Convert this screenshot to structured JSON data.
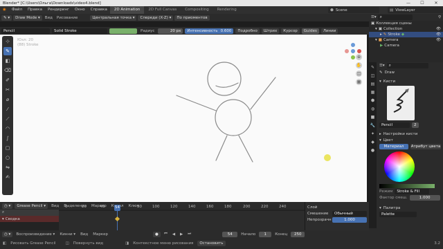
{
  "window": {
    "title": "Blender* [C:\\Users\\Ольга\\Downloads\\video4.blend]"
  },
  "menu": {
    "items": [
      "Файл",
      "Правка",
      "Рендеринг",
      "Окно",
      "Справка"
    ]
  },
  "workspace_tabs": [
    {
      "label": "2D Animation",
      "active": true
    },
    {
      "label": "2D Full Canvas",
      "active": false
    },
    {
      "label": "Compositing",
      "active": false
    },
    {
      "label": "Rendering",
      "active": false
    }
  ],
  "scene": {
    "name": "Scene"
  },
  "view_layer": {
    "name": "ViewLayer"
  },
  "header": {
    "mode": "Draw Mode",
    "view": "Вид",
    "draw": "Рисование",
    "pivot": "Центральная точка",
    "orient": "Спереди (X-Z)",
    "snap": "По приоментов"
  },
  "tool_header": {
    "brush": "Pencil",
    "material": "Solid Stroke",
    "radius_label": "Радиус",
    "radius_value": "20 px",
    "strength_label": "Интенсивность",
    "strength_value": "0.600",
    "detail": "Подробно",
    "stroke": "Штрих",
    "cursor": "Курсор",
    "guides": "Guides",
    "lines": "Линии"
  },
  "viewport": {
    "info_line1": "Юзл: 20",
    "info_line2": "(88) Stroke"
  },
  "colors": {
    "accent": "#4772b3",
    "strength": "#79b06a",
    "keyframe": "#d8b13a"
  },
  "timeline": {
    "mode": "Grease Pencil",
    "menus": [
      "Вид",
      "Выделение",
      "Маркер",
      "Канал",
      "Ключ"
    ],
    "ticks": [
      "0",
      "20",
      "40",
      "54",
      "80",
      "100",
      "120",
      "140",
      "160",
      "180",
      "200",
      "220",
      "240"
    ],
    "current_frame": "54",
    "channels": [
      "Сводка"
    ]
  },
  "layer_panel": {
    "title": "Слой",
    "blend_label": "Смешение",
    "blend_value": "Обычный",
    "opacity_label": "Непрозрачн",
    "opacity_value": "1.000"
  },
  "playback": {
    "playback_label": "Воспроизведение",
    "keying_label": "Кинни",
    "view_label": "Вид",
    "marker_label": "Маркер",
    "frame": "54",
    "start_label": "Начало",
    "start_value": "1",
    "end_label": "Конец",
    "end_value": "250"
  },
  "status": {
    "draw": "Рисовать Grease Pencil",
    "rotate": "Повернуть вид",
    "context": "Контекстное меню рисования",
    "stop": "Остановить",
    "version": "3.2"
  },
  "outliner": {
    "root": "Коллекция сцены",
    "items": [
      "Collection",
      "Stroke",
      "Camera",
      "Camera"
    ]
  },
  "properties": {
    "tool_name": "Draw",
    "brushes_section": "Кисти",
    "brush_name": "Pencil",
    "brush_users": "2",
    "brush_settings": "Настройки кисти",
    "color_section": "Цвет",
    "material_tab": "Материал",
    "vertex_tab": "Атрибут цвета",
    "mode_label": "Режим",
    "mode_value": "Stroke & Fill",
    "mix_label": "Фактор смеш.",
    "mix_value": "1.000",
    "palette": "Палитра",
    "palette_name": "Palette"
  }
}
